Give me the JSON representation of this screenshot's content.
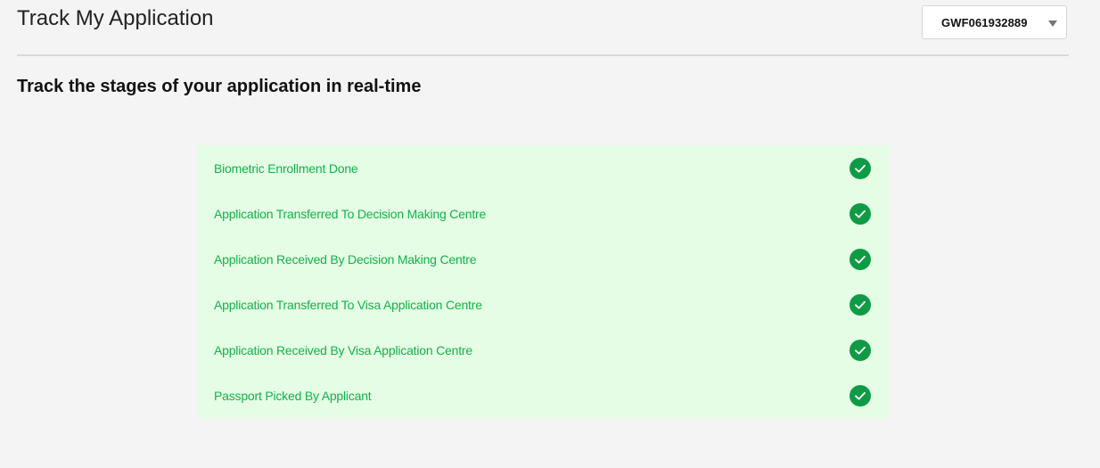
{
  "header": {
    "title": "Track My Application",
    "application_select": {
      "selected_value": "GWF061932889"
    }
  },
  "main": {
    "heading": "Track the stages of your application in real-time",
    "stages": [
      {
        "label": "Biometric Enrollment Done",
        "status": "complete"
      },
      {
        "label": "Application Transferred To Decision Making Centre",
        "status": "complete"
      },
      {
        "label": "Application Received By Decision Making Centre",
        "status": "complete"
      },
      {
        "label": "Application Transferred To Visa Application Centre",
        "status": "complete"
      },
      {
        "label": "Application Received By Visa Application Centre",
        "status": "complete"
      },
      {
        "label": "Passport Picked By Applicant",
        "status": "complete"
      }
    ]
  },
  "colors": {
    "stage_text": "#13b24b",
    "check_fill": "#0f9b46",
    "panel_bg": "#e4fde4"
  }
}
